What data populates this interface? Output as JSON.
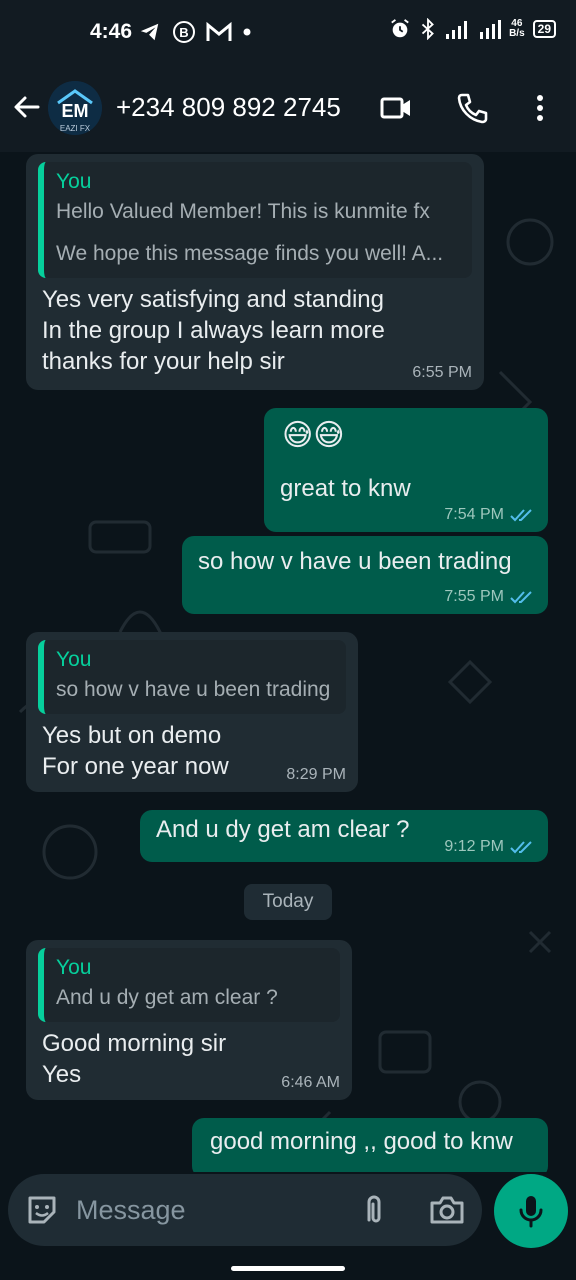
{
  "status": {
    "time": "4:46",
    "net_speed_top": "46",
    "net_speed_bottom": "B/s",
    "signal_label": "4G",
    "battery": "29"
  },
  "header": {
    "contact_name": "+234 809 892 2745",
    "avatar_text": "EM",
    "avatar_sub": "EAZI FX"
  },
  "messages": [
    {
      "quote_author": "You",
      "quote_line1": "Hello Valued Member! This is kunmite fx",
      "quote_line2": "We hope this message finds you well! A...",
      "text": "Yes very satisfying and standing\nIn the group I always learn more\nthanks for your help sir",
      "time": "6:55 PM"
    },
    {
      "emoji": "😅😅",
      "text": "great to knw",
      "time": "7:54 PM"
    },
    {
      "text": "so how v have u been trading",
      "time": "7:55 PM"
    },
    {
      "quote_author": "You",
      "quote_text": "so how v have u been trading",
      "text": "Yes but on demo\nFor one year now",
      "time": "8:29 PM"
    },
    {
      "text": "And u dy get am clear ?",
      "time": "9:12 PM"
    },
    {
      "quote_author": "You",
      "quote_text": "And u dy get am clear ?",
      "text": "Good morning sir\nYes",
      "time": "6:46 AM"
    },
    {
      "text": "good morning ,, good to knw"
    }
  ],
  "date_chip": "Today",
  "input": {
    "placeholder": "Message"
  },
  "colors": {
    "accent": "#00a884",
    "outgoing_bubble": "#005c4b",
    "incoming_bubble": "#202c33",
    "read_ticks": "#53bdeb"
  }
}
